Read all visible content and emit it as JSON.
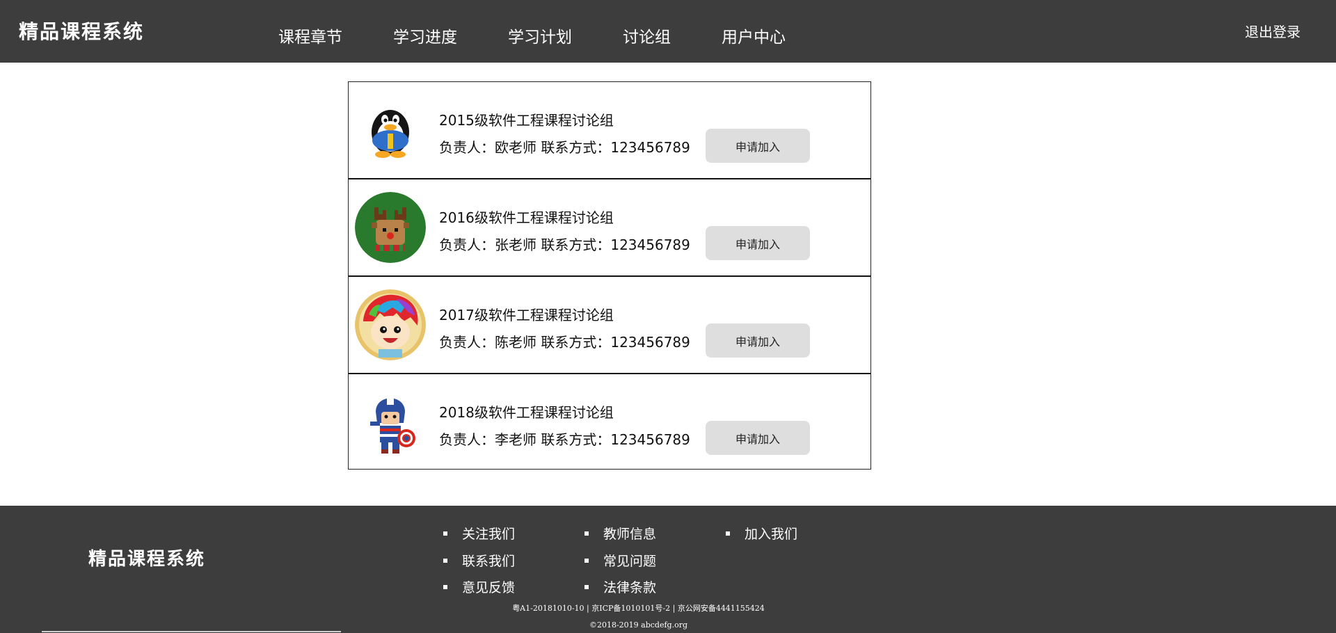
{
  "header": {
    "brand": "精品课程系统",
    "nav": [
      "课程章节",
      "学习进度",
      "学习计划",
      "讨论组",
      "用户中心"
    ],
    "logout": "退出登录"
  },
  "groups": [
    {
      "name": "2015级软件工程课程讨论组",
      "meta": "负责人：欧老师 联系方式：123456789",
      "button": "申请加入",
      "avatar": "penguin-avatar-icon"
    },
    {
      "name": "2016级软件工程课程讨论组",
      "meta": "负责人：张老师 联系方式：123456789",
      "button": "申请加入",
      "avatar": "reindeer-avatar-icon"
    },
    {
      "name": "2017级软件工程课程讨论组",
      "meta": "负责人：陈老师 联系方式：123456789",
      "button": "申请加入",
      "avatar": "cartoon-boy-avatar-icon"
    },
    {
      "name": "2018级软件工程课程讨论组",
      "meta": "负责人：李老师 联系方式：123456789",
      "button": "申请加入",
      "avatar": "captain-avatar-icon"
    }
  ],
  "footer": {
    "brand": "精品课程系统",
    "links": [
      "关注我们",
      "教师信息",
      "加入我们",
      "联系我们",
      "常见问题",
      "意见反馈",
      "法律条款"
    ],
    "icp": "粤A1-20181010-10 | 京ICP备1010101号-2 | 京公网安备4441155424",
    "copyright": "©2018-2019 abcdefg.org"
  },
  "colors": {
    "bar_background": "#3d3d3d",
    "button_background": "#dedede",
    "text_light": "#ffffff"
  }
}
